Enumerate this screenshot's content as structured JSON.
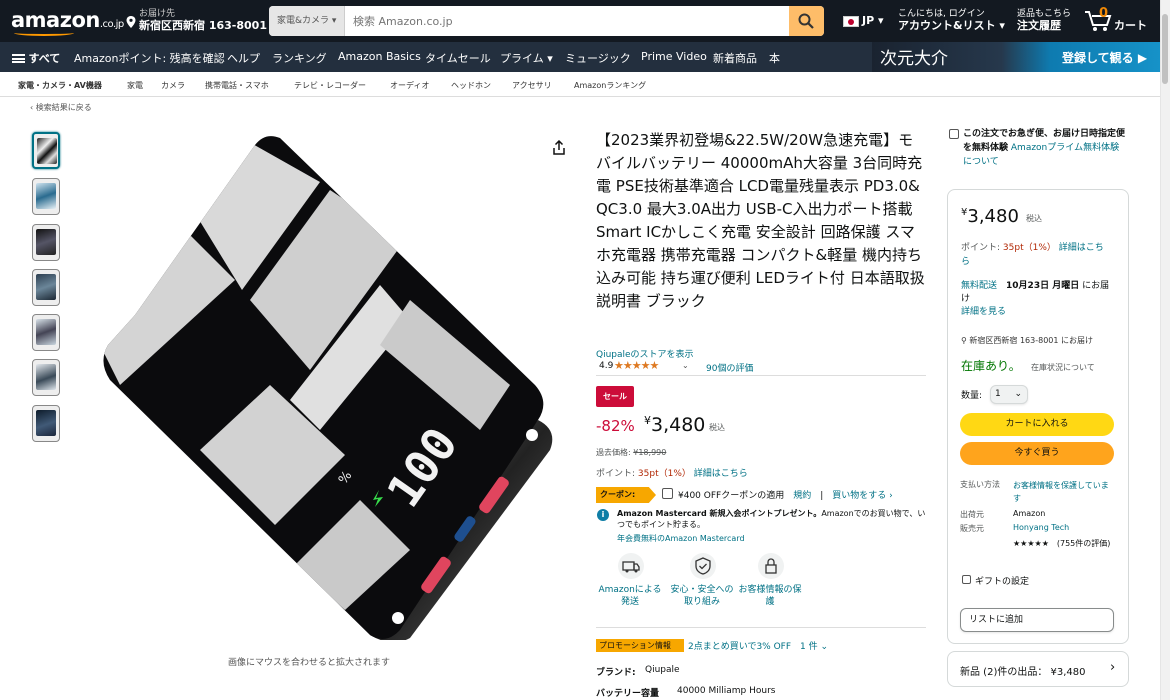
{
  "header": {
    "logo": "amazon",
    "logo_suffix": ".co.jp",
    "deliver_label": "お届け先",
    "deliver_location": "新宿区西新宿 163-8001",
    "search_category": "家電&カメラ",
    "search_placeholder": "検索 Amazon.co.jp",
    "lang": "JP",
    "account_line1": "こんにちは, ログイン",
    "account_line2": "アカウント&リスト",
    "orders_line1": "返品もこちら",
    "orders_line2": "注文履歴",
    "cart_count": "0",
    "cart_label": "カート"
  },
  "subnav": {
    "items": [
      "すべて",
      "Amazonポイント: 残高を確認",
      "ヘルプ",
      "ランキング",
      "Amazon Basics",
      "タイムセール",
      "プライム",
      "ミュージック",
      "Prime Video",
      "新着商品",
      "本"
    ],
    "banner_title": "次元大介",
    "banner_cta": "登録して観る ▶"
  },
  "catbar": {
    "items": [
      "家電・カメラ・AV機器",
      "家電",
      "カメラ",
      "携帯電話・スマホ",
      "テレビ・レコーダー",
      "オーディオ",
      "ヘッドホン",
      "アクセサリ",
      "Amazonランキング"
    ]
  },
  "back_link": "‹ 検索結果に戻る",
  "zoom_hint": "画像にマウスを合わせると拡大されます",
  "product": {
    "title": "【2023業界初登場&22.5W/20W急速充電】モバイルバッテリー 40000mAh大容量 3台同時充電 PSE技術基準適合 LCD電量残量表示 PD3.0& QC3.0 最大3.0A出力 USB-C入出力ポート搭載 Smart ICかしこく充電 安全設計 回路保護 スマホ充電器 携帯充電器 コンパクト&軽量 機内持ち込み可能 持ち運び便利 LEDライト付 日本語取扱説明書 ブラック",
    "store": "Qiupaleのストアを表示",
    "rating": "4.9",
    "stars": "★★★★★",
    "rating_count": "90個の評価",
    "display_reading": "100",
    "sale_badge": "セール",
    "discount": "-82%",
    "price": "3,480",
    "price_symbol": "¥",
    "tax": "税込",
    "list_price_label": "過去価格:",
    "list_price": "¥18,990",
    "points_label": "ポイント:",
    "points_value": "35pt（1%）",
    "points_link": "詳細はこちら",
    "coupon_badge": "クーポン:",
    "coupon_text": "¥400 OFFクーポンの適用",
    "coupon_terms": "規約",
    "coupon_shop": "買い物をする ›",
    "mastercard_bold": "Amazon Mastercard 新規入会ポイントプレゼント。",
    "mastercard_text": "Amazonでのお買い物で、いつでもポイント貯まる。",
    "mastercard_link": "年会費無料のAmazon Mastercard",
    "features": [
      "Amazonによる発送",
      "安心・安全への取り組み",
      "お客様情報の保護"
    ],
    "promo_badge": "プロモーション情報",
    "promo_text": "2点まとめ買いで3% OFF　1 件 ⌄",
    "brand_label": "ブランド:",
    "brand_value": "Qiupale",
    "capacity_label": "バッテリー容量",
    "capacity_value": "40000 Milliamp Hours"
  },
  "buybox": {
    "prime_text": "この注文でお急ぎ便、お届け日時指定便を無料体験",
    "prime_link": "Amazonプライム無料体験について",
    "price": "3,480",
    "price_symbol": "¥",
    "tax": "税込",
    "points_label": "ポイント:",
    "points_value": "35pt（1%）",
    "points_link": "詳細はこちら",
    "free_delivery": "無料配送",
    "delivery_date": "10月23日 月曜日",
    "delivery_suffix": "にお届け",
    "delivery_link": "詳細を見る",
    "location": "新宿区西新宿 163-8001 にお届け",
    "stock": "在庫あり。",
    "stock_note": "在庫状況について",
    "qty_label": "数量:",
    "qty_value": "1",
    "add_to_cart": "カートに入れる",
    "buy_now": "今すぐ買う",
    "payment_label": "支払い方法",
    "payment_value": "お客様情報を保護しています",
    "ships_label": "出荷元",
    "ships_value": "Amazon",
    "seller_label": "販売元",
    "seller_value": "Honyang Tech",
    "seller_rating": "★★★★★　(755件の評価)",
    "gift": "ギフトの設定",
    "add_to_list": "リストに追加",
    "used_offers": "新品 (2)件の出品：",
    "used_price": "¥3,480"
  },
  "colors": {
    "nav_dark": "#131921",
    "nav_mid": "#232f3e",
    "accent_orange": "#febd69",
    "sale_red": "#cc0c39",
    "link_teal": "#007185",
    "cart_yellow": "#ffd814",
    "buy_orange": "#ffa41c",
    "stock_green": "#007600"
  }
}
